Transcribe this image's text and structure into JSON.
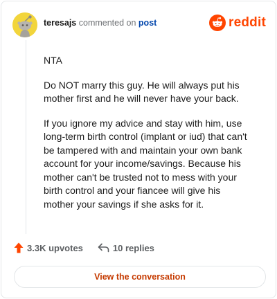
{
  "header": {
    "author": "teresajs",
    "action_text": "commented on",
    "post_link": "post",
    "brand": "reddit"
  },
  "comment": {
    "paragraphs": [
      "NTA",
      "Do NOT marry this guy. He will always put his mother first and he will never have your back.",
      "If you ignore my advice and stay with him, use long-term birth control (implant or iud) that can't be tampered with and maintain your own bank account for your income/savings. Because his mother can't be trusted not to mess with your birth control and your fiancee will give his mother your savings if she asks for it."
    ]
  },
  "actions": {
    "upvotes": "3.3K upvotes",
    "upvote_icon": "upvote-arrow-icon",
    "replies": "10 replies",
    "reply_icon": "reply-arrow-icon"
  },
  "cta": {
    "label": "View the conversation"
  },
  "colors": {
    "brand": "#ff4500",
    "link": "#0045ac",
    "cta_text": "#c53a00",
    "avatar_bg": "#f2d53c"
  }
}
